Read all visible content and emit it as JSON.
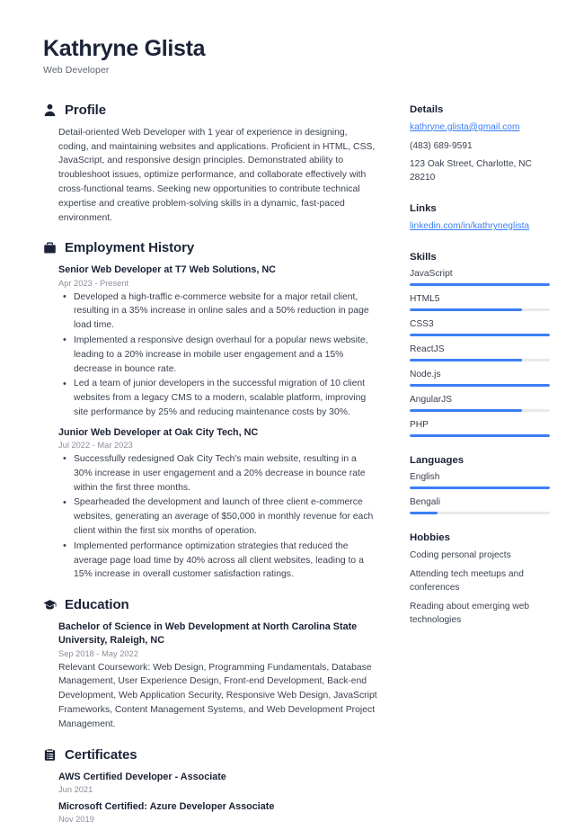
{
  "header": {
    "name": "Kathryne Glista",
    "title": "Web Developer"
  },
  "sections": {
    "profile": {
      "icon": "person-icon",
      "title": "Profile",
      "text": "Detail-oriented Web Developer with 1 year of experience in designing, coding, and maintaining websites and applications. Proficient in HTML, CSS, JavaScript, and responsive design principles. Demonstrated ability to troubleshoot issues, optimize performance, and collaborate effectively with cross-functional teams. Seeking new opportunities to contribute technical expertise and creative problem-solving skills in a dynamic, fast-paced environment."
    },
    "employment": {
      "icon": "briefcase-icon",
      "title": "Employment History",
      "jobs": [
        {
          "title": "Senior Web Developer at T7 Web Solutions, NC",
          "date": "Apr 2023 - Present",
          "bullets": [
            "Developed a high-traffic e-commerce website for a major retail client, resulting in a 35% increase in online sales and a 50% reduction in page load time.",
            "Implemented a responsive design overhaul for a popular news website, leading to a 20% increase in mobile user engagement and a 15% decrease in bounce rate.",
            "Led a team of junior developers in the successful migration of 10 client websites from a legacy CMS to a modern, scalable platform, improving site performance by 25% and reducing maintenance costs by 30%."
          ]
        },
        {
          "title": "Junior Web Developer at Oak City Tech, NC",
          "date": "Jul 2022 - Mar 2023",
          "bullets": [
            "Successfully redesigned Oak City Tech's main website, resulting in a 30% increase in user engagement and a 20% decrease in bounce rate within the first three months.",
            "Spearheaded the development and launch of three client e-commerce websites, generating an average of $50,000 in monthly revenue for each client within the first six months of operation.",
            "Implemented performance optimization strategies that reduced the average page load time by 40% across all client websites, leading to a 15% increase in overall customer satisfaction ratings."
          ]
        }
      ]
    },
    "education": {
      "icon": "graduation-cap-icon",
      "title": "Education",
      "entries": [
        {
          "title": "Bachelor of Science in Web Development at North Carolina State University, Raleigh, NC",
          "date": "Sep 2018 - May 2022",
          "description": "Relevant Coursework: Web Design, Programming Fundamentals, Database Management, User Experience Design, Front-end Development, Back-end Development, Web Application Security, Responsive Web Design, JavaScript Frameworks, Content Management Systems, and Web Development Project Management."
        }
      ]
    },
    "certificates": {
      "icon": "clipboard-icon",
      "title": "Certificates",
      "entries": [
        {
          "title": "AWS Certified Developer - Associate",
          "date": "Jun 2021"
        },
        {
          "title": "Microsoft Certified: Azure Developer Associate",
          "date": "Nov 2019"
        }
      ]
    }
  },
  "sidebar": {
    "details": {
      "title": "Details",
      "email": "kathryne.glista@gmail.com",
      "phone": "(483) 689-9591",
      "address": "123 Oak Street, Charlotte, NC 28210"
    },
    "links": {
      "title": "Links",
      "items": [
        {
          "label": "linkedin.com/in/kathryneglista"
        }
      ]
    },
    "skills": {
      "title": "Skills",
      "items": [
        {
          "label": "JavaScript",
          "level": 100
        },
        {
          "label": "HTML5",
          "level": 80
        },
        {
          "label": "CSS3",
          "level": 100
        },
        {
          "label": "ReactJS",
          "level": 80
        },
        {
          "label": "Node.js",
          "level": 100
        },
        {
          "label": "AngularJS",
          "level": 80
        },
        {
          "label": "PHP",
          "level": 100
        }
      ]
    },
    "languages": {
      "title": "Languages",
      "items": [
        {
          "label": "English",
          "level": 100
        },
        {
          "label": "Bengali",
          "level": 20
        }
      ]
    },
    "hobbies": {
      "title": "Hobbies",
      "items": [
        "Coding personal projects",
        "Attending tech meetups and conferences",
        "Reading about emerging web technologies"
      ]
    }
  },
  "colors": {
    "accent": "#3b7ff5",
    "heading": "#1c2237",
    "body": "#3b414f",
    "muted": "#8a8f99",
    "track": "#e8e9eb"
  }
}
